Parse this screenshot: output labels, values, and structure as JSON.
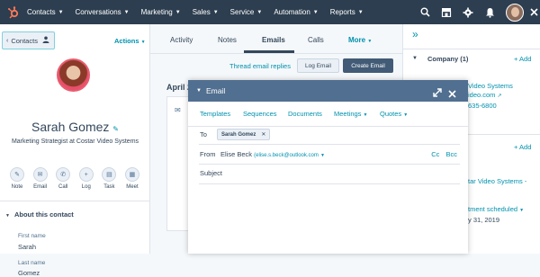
{
  "topnav": {
    "brand_color": "#ff7a59",
    "items": [
      {
        "label": "Contacts"
      },
      {
        "label": "Conversations"
      },
      {
        "label": "Marketing"
      },
      {
        "label": "Sales"
      },
      {
        "label": "Service"
      },
      {
        "label": "Automation"
      },
      {
        "label": "Reports"
      }
    ],
    "icons": [
      "search-icon",
      "marketplace-icon",
      "settings-icon",
      "notifications-icon"
    ]
  },
  "sidebar": {
    "back_label": "Contacts",
    "actions_label": "Actions",
    "contact": {
      "name": "Sarah Gomez",
      "title": "Marketing Strategist at Costar Video Systems"
    },
    "quick_actions": [
      {
        "label": "Note",
        "icon": "note-icon",
        "glyph": "✎"
      },
      {
        "label": "Email",
        "icon": "email-icon",
        "glyph": "✉"
      },
      {
        "label": "Call",
        "icon": "call-icon",
        "glyph": "✆"
      },
      {
        "label": "Log",
        "icon": "log-icon",
        "glyph": "+"
      },
      {
        "label": "Task",
        "icon": "task-icon",
        "glyph": "▤"
      },
      {
        "label": "Meet",
        "icon": "meet-icon",
        "glyph": "▦"
      }
    ],
    "about_title": "About this contact",
    "fields": [
      {
        "label": "First name",
        "value": "Sarah"
      },
      {
        "label": "Last name",
        "value": "Gomez"
      }
    ]
  },
  "main": {
    "tabs": [
      {
        "label": "Activity"
      },
      {
        "label": "Notes"
      },
      {
        "label": "Emails"
      },
      {
        "label": "Calls"
      },
      {
        "label": "More"
      }
    ],
    "thread_link": "Thread email replies",
    "log_email_label": "Log Email",
    "create_email_label": "Create Email",
    "date_header": "April 2"
  },
  "right_panel": {
    "company_header": "Company (1)",
    "add_label": "+ Add",
    "company_lines": [
      "Video Systems",
      "ideo.com",
      "635-6800"
    ],
    "second_add_label": "+ Add",
    "deal_lines": [
      "tar Video Systems -",
      "tment scheduled",
      "y 31, 2019"
    ]
  },
  "email_modal": {
    "title": "Email",
    "toolbar": {
      "templates": "Templates",
      "sequences": "Sequences",
      "documents": "Documents",
      "meetings": "Meetings",
      "quotes": "Quotes"
    },
    "to_label": "To",
    "recipient": "Sarah Gomez",
    "from_label": "From",
    "from_name": "Elise Beck",
    "from_email": "(elise.s.beck@outlook.com",
    "cc_label": "Cc",
    "bcc_label": "Bcc",
    "subject_label": "Subject"
  }
}
